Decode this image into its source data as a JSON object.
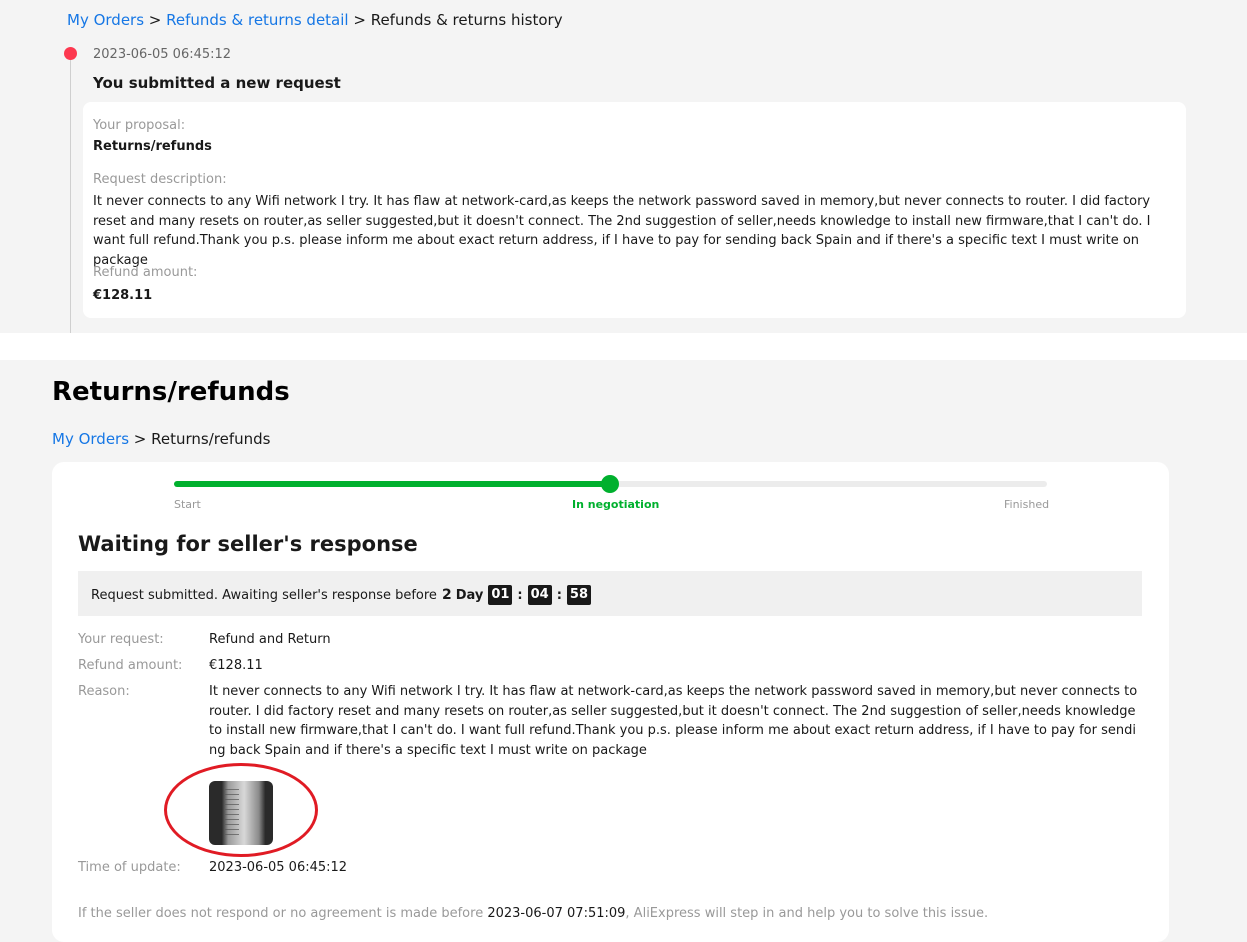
{
  "history": {
    "breadcrumb": {
      "my_orders": "My Orders",
      "sep1": " > ",
      "detail": "Refunds & returns detail",
      "sep2": " > ",
      "current": "Refunds & returns history"
    },
    "entry": {
      "time": "2023-06-05 06:45:12",
      "title": "You submitted a new request",
      "proposal_label": "Your proposal:",
      "proposal_value": "Returns/refunds",
      "description_label": "Request description:",
      "description": "It never connects to any Wifi network I try. It has flaw at network-card,as keeps the network password saved in memory,but never connects to router. I did factory reset and many resets on router,as seller suggested,but it doesn't connect. The 2nd suggestion of seller,needs knowledge to install new firmware,that I can't do. I want full refund.Thank you p.s. please inform me about exact return address, if I have to pay for sending back Spain and if there's a specific text I must write on package",
      "amount_label": "Refund amount:",
      "amount_value": "€128.11"
    }
  },
  "main": {
    "title": "Returns/refunds",
    "breadcrumb": {
      "my_orders": "My Orders",
      "sep": " > ",
      "current": "Returns/refunds"
    },
    "progress": {
      "steps": [
        "Start",
        "In negotiation",
        "Finished"
      ],
      "active_index": 1,
      "fraction": 0.5,
      "active_color": "#00b02e"
    },
    "status_title": "Waiting for seller's response",
    "notice": {
      "text": "Request submitted. Awaiting seller's response before",
      "days": "2",
      "day_word": "Day",
      "hours": "01",
      "minutes": "04",
      "seconds": "58",
      "sep": ":"
    },
    "fields": {
      "request_label": "Your request:",
      "request_value": "Refund and Return",
      "amount_label": "Refund amount:",
      "amount_value": "€128.11",
      "reason_label": "Reason:",
      "reason_value": "It never connects to any Wifi network I try. It has flaw at network-card,as keeps the network password saved in memory,but never connects to router. I did factory reset and many resets on router,as seller suggested,but it doesn't connect. The 2nd suggestion of seller,needs knowledge to install new firmware,that I can't do. I want full refund.Thank you p.s. please inform me about exact return address, if I have to pay for sending back Spain and if there's a specific text I must write on package",
      "update_label": "Time of update:",
      "update_value": "2023-06-05 06:45:12"
    },
    "footer": {
      "before": "If the seller does not respond or no agreement is made before ",
      "datetime": "2023-06-07 07:51:09",
      "after": ", AliExpress will step in and help you to solve this issue."
    }
  },
  "colors": {
    "link": "#1677e5",
    "accent_green": "#00b02e",
    "timeline_dot": "#fd384f",
    "annotation_circle": "#e01b24"
  }
}
